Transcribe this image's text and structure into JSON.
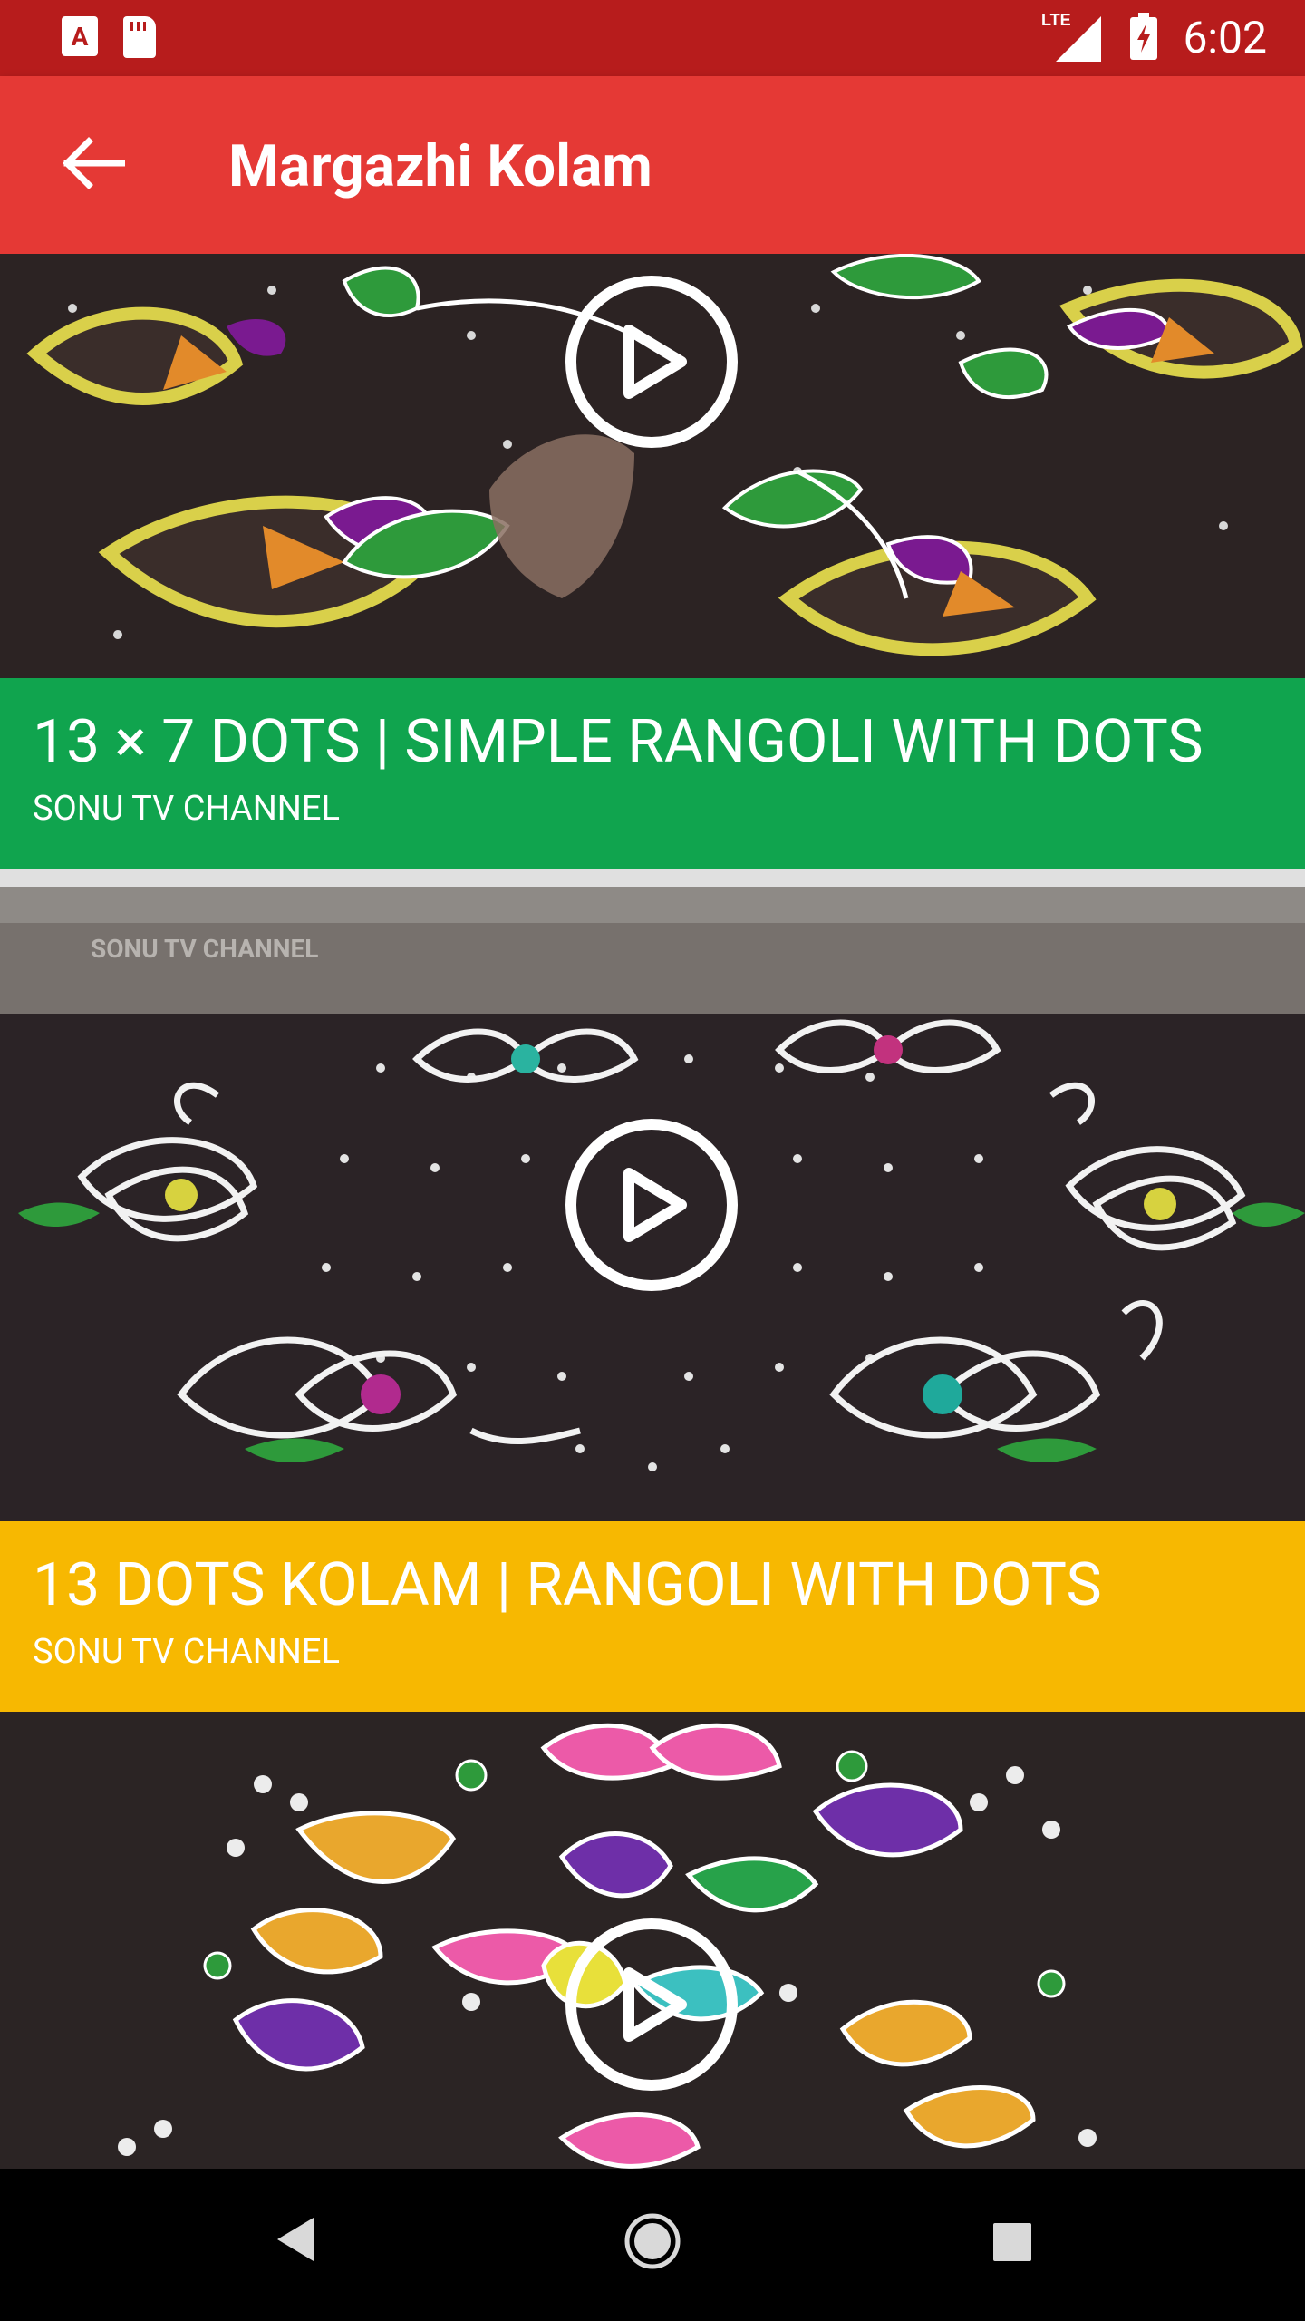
{
  "status_bar": {
    "time": "6:02",
    "network": "LTE",
    "icons": [
      "app-a-icon",
      "sd-card-icon",
      "signal-icon",
      "battery-charging-icon"
    ]
  },
  "app_bar": {
    "title": "Margazhi Kolam",
    "back_icon": "arrow-left-icon"
  },
  "videos": [
    {
      "title": "13 × 7 DOTS | SIMPLE RANGOLI WITH DOTS",
      "channel": "SONU TV CHANNEL",
      "footer_color": "#10a44e"
    },
    {
      "title": "13 DOTS KOLAM | RANGOLI WITH DOTS",
      "channel": "SONU TV CHANNEL",
      "footer_color": "#f7b801",
      "watermark": "SONU TV CHANNEL"
    },
    {
      "title": "",
      "channel": ""
    }
  ],
  "nav_bar": {
    "buttons": [
      "back-triangle-icon",
      "home-circle-icon",
      "recents-square-icon"
    ]
  },
  "colors": {
    "status_bar": "#b71c1c",
    "app_bar": "#e53935",
    "nav_bar": "#000000"
  }
}
